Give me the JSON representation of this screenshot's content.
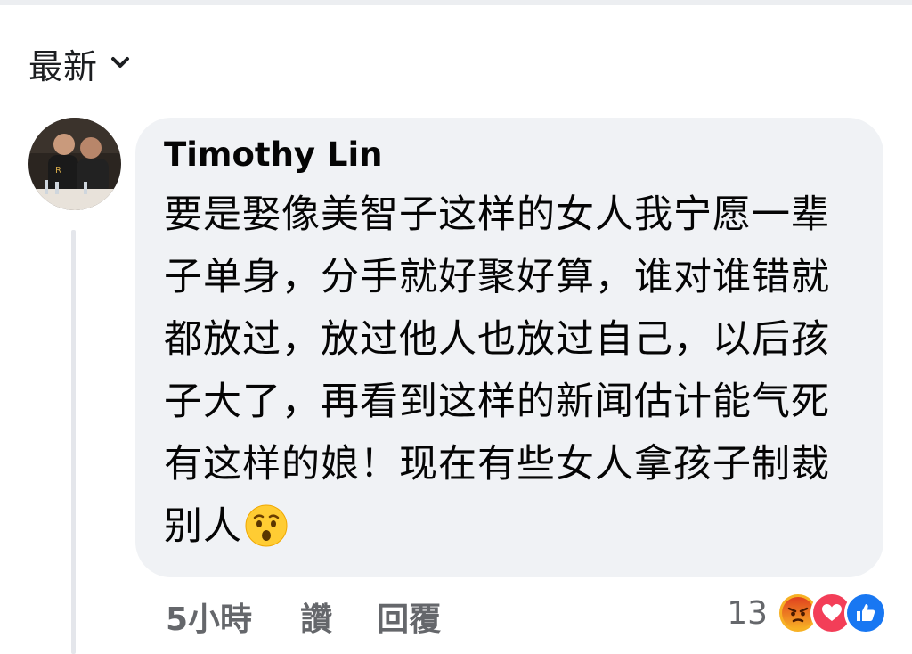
{
  "sort": {
    "label": "最新",
    "icon": "chevron-down-icon"
  },
  "comment": {
    "author": "Timothy Lin",
    "text": "要是娶像美智子这样的女人我宁愿一辈子单身，分手就好聚好算，谁对谁错就都放过，放过他人也放过自己，以后孩子大了，再看到这样的新闻估计能气死有这样的娘！现在有些女人拿孩子制裁别人",
    "emoji": "hushed-face-emoji",
    "time": "5小時",
    "like_label": "讚",
    "reply_label": "回覆",
    "reaction_count": "13",
    "reactions": [
      "angry-icon",
      "love-icon",
      "like-icon"
    ]
  },
  "colors": {
    "bubble": "#f0f2f5",
    "muted": "#65676b",
    "like_blue": "#1877f2",
    "love_red": "#f33e58",
    "angry_orange": "#e9710f"
  }
}
